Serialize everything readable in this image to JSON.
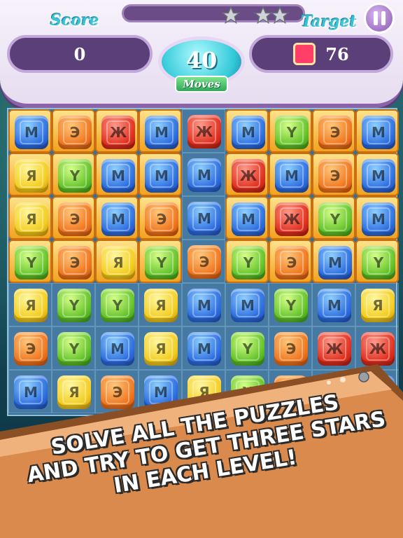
{
  "hud": {
    "score_label": "Score",
    "target_label": "Target",
    "score_value": "0",
    "moves_value": "40",
    "moves_label": "Moves",
    "target_count": "76",
    "target_color": "#ff3f67",
    "stars_earned": 0,
    "stars_total": 3
  },
  "board": {
    "rows": 7,
    "cols": 9,
    "grid": [
      [
        {
          "c": "blue",
          "f": 1
        },
        {
          "c": "orange",
          "f": 1
        },
        {
          "c": "red",
          "f": 1
        },
        {
          "c": "blue",
          "f": 1
        },
        {
          "c": "red",
          "f": 0
        },
        {
          "c": "blue",
          "f": 1
        },
        {
          "c": "green",
          "f": 1
        },
        {
          "c": "orange",
          "f": 1
        },
        {
          "c": "blue",
          "f": 1
        }
      ],
      [
        {
          "c": "yellow",
          "f": 1
        },
        {
          "c": "green",
          "f": 1
        },
        {
          "c": "blue",
          "f": 1
        },
        {
          "c": "blue",
          "f": 1
        },
        {
          "c": "blue",
          "f": 0
        },
        {
          "c": "red",
          "f": 1
        },
        {
          "c": "blue",
          "f": 1
        },
        {
          "c": "orange",
          "f": 1
        },
        {
          "c": "blue",
          "f": 1
        }
      ],
      [
        {
          "c": "yellow",
          "f": 1
        },
        {
          "c": "orange",
          "f": 1
        },
        {
          "c": "blue",
          "f": 1
        },
        {
          "c": "orange",
          "f": 1
        },
        {
          "c": "blue",
          "f": 0
        },
        {
          "c": "blue",
          "f": 1
        },
        {
          "c": "red",
          "f": 1
        },
        {
          "c": "green",
          "f": 1
        },
        {
          "c": "blue",
          "f": 1
        }
      ],
      [
        {
          "c": "green",
          "f": 1
        },
        {
          "c": "orange",
          "f": 1
        },
        {
          "c": "yellow",
          "f": 1
        },
        {
          "c": "green",
          "f": 1
        },
        {
          "c": "orange",
          "f": 0
        },
        {
          "c": "green",
          "f": 1
        },
        {
          "c": "orange",
          "f": 1
        },
        {
          "c": "blue",
          "f": 1
        },
        {
          "c": "green",
          "f": 1
        }
      ],
      [
        {
          "c": "yellow",
          "f": 0
        },
        {
          "c": "green",
          "f": 0
        },
        {
          "c": "green",
          "f": 0
        },
        {
          "c": "yellow",
          "f": 0
        },
        {
          "c": "blue",
          "f": 0
        },
        {
          "c": "blue",
          "f": 0
        },
        {
          "c": "green",
          "f": 0
        },
        {
          "c": "blue",
          "f": 0
        },
        {
          "c": "yellow",
          "f": 0
        }
      ],
      [
        {
          "c": "orange",
          "f": 0
        },
        {
          "c": "green",
          "f": 0
        },
        {
          "c": "blue",
          "f": 0
        },
        {
          "c": "yellow",
          "f": 0
        },
        {
          "c": "blue",
          "f": 0
        },
        {
          "c": "green",
          "f": 0
        },
        {
          "c": "orange",
          "f": 0
        },
        {
          "c": "red",
          "f": 0
        },
        {
          "c": "red",
          "f": 0
        }
      ],
      [
        {
          "c": "blue",
          "f": 0
        },
        {
          "c": "yellow",
          "f": 0
        },
        {
          "c": "orange",
          "f": 0
        },
        {
          "c": "blue",
          "f": 0
        },
        {
          "c": "yellow",
          "f": 0
        },
        {
          "c": "green",
          "f": 0
        },
        {
          "c": "orange",
          "f": 0
        },
        {
          "c": "red",
          "f": 0
        },
        {
          "c": "blue",
          "f": 0
        }
      ]
    ]
  },
  "banner": {
    "line1": "SOLVE ALL THE PUZZLES",
    "line2": "AND TRY TO GET THREE STARS",
    "line3": "IN EACH LEVEL!"
  }
}
